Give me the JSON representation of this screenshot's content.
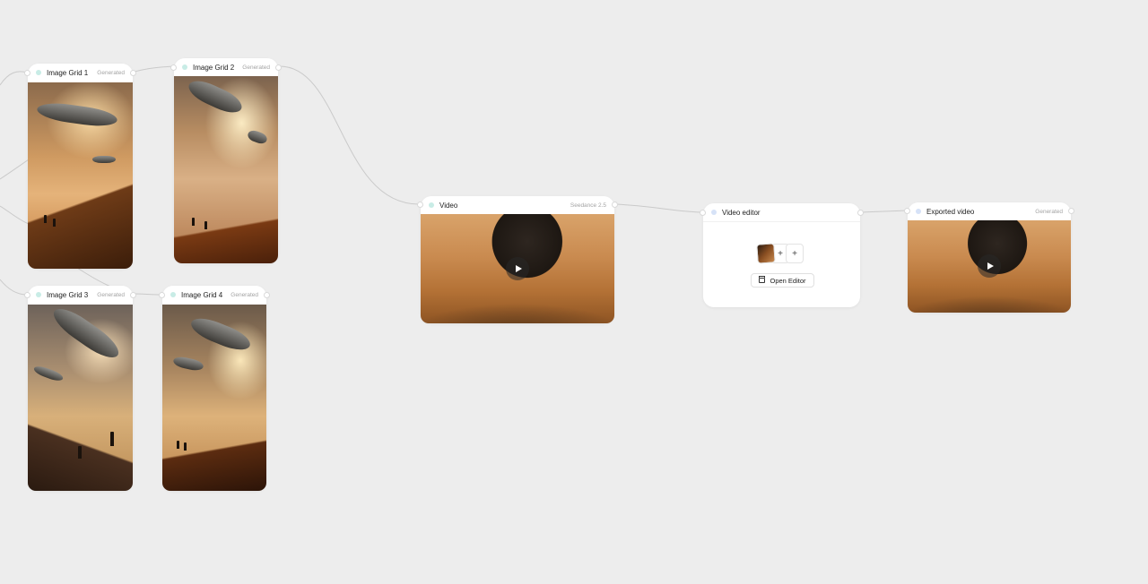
{
  "nodes": {
    "grid1": {
      "title": "Image Grid 1",
      "status": "Generated"
    },
    "grid2": {
      "title": "Image Grid 2",
      "status": "Generated"
    },
    "grid3": {
      "title": "Image Grid 3",
      "status": "Generated"
    },
    "grid4": {
      "title": "Image Grid 4",
      "status": "Generated"
    },
    "video": {
      "title": "Video",
      "status": "Seedance 2.5"
    },
    "editor": {
      "title": "Video editor",
      "open_label": "Open Editor",
      "add_symbol": "+"
    },
    "exported": {
      "title": "Exported video",
      "status": "Generated"
    }
  },
  "colors": {
    "background": "#ededed",
    "node": "#ffffff",
    "edge": "#c9c9c9",
    "dot_teal": "#c8ece6",
    "dot_blue": "#d6e2f7"
  }
}
